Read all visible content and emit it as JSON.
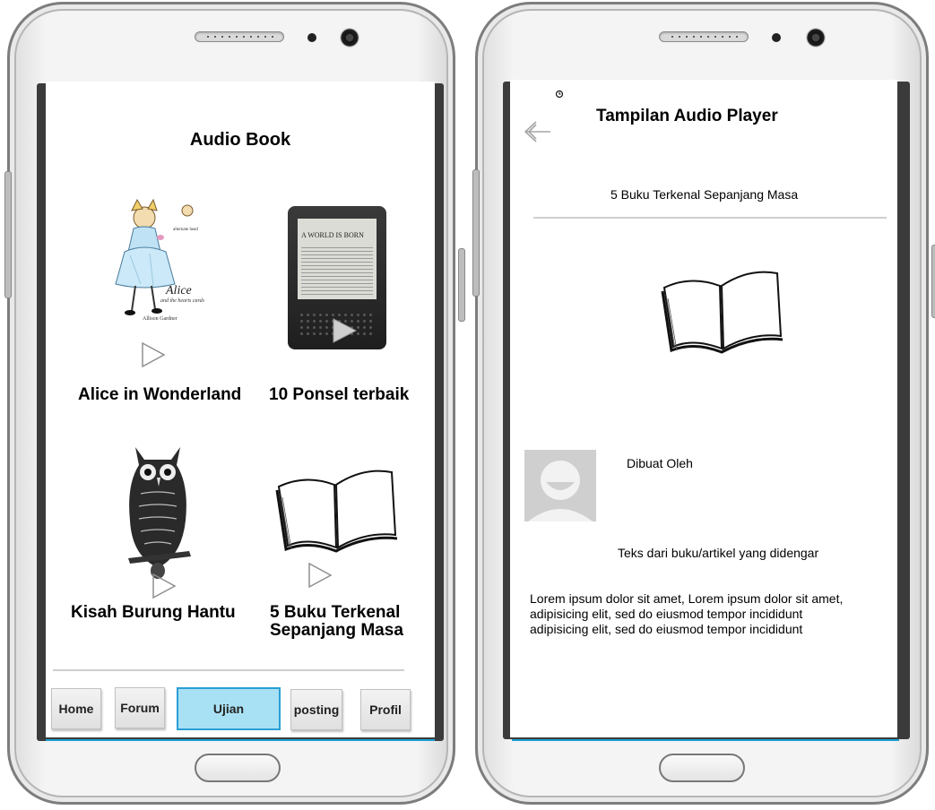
{
  "audio_book_screen": {
    "title": "Audio Book",
    "books": [
      {
        "title": "Alice in Wonderland",
        "cover_icon": "alice-cover-icon"
      },
      {
        "title": "10 Ponsel terbaik",
        "cover_icon": "ereader-icon"
      },
      {
        "title": "Kisah Burung Hantu",
        "cover_icon": "owl-icon"
      },
      {
        "title_line1": "5 Buku Terkenal",
        "title_line2": "Sepanjang Masa",
        "cover_icon": "open-book-icon"
      }
    ],
    "cover_text": {
      "alice_script": "Alice",
      "alice_sub": "and the hearts cards",
      "alice_author": "Allison Gardner",
      "alice_tag": "alternate head",
      "ereader_heading": "A WORLD IS BORN"
    },
    "nav": {
      "home": "Home",
      "forum": "Forum",
      "ujian": "Ujian",
      "posting": "posting",
      "profil": "Profil",
      "active": "Ujian"
    }
  },
  "player_screen": {
    "title": "Tampilan Audio Player",
    "book_title": "5 Buku Terkenal Sepanjang Masa",
    "author_label": "Dibuat Oleh",
    "text_heading": "Teks dari buku/artikel yang didengar",
    "body_lines": [
      "Lorem ipsum dolor sit amet, Lorem ipsum dolor sit amet,",
      "adipisicing elit, sed do eiusmod tempor incididunt",
      "adipisicing elit, sed do eiusmod tempor incididunt"
    ]
  },
  "colors": {
    "active_nav_fill": "#a9e1f4",
    "active_nav_border": "#2a9ed4",
    "accent_line": "#1aa0d0"
  }
}
